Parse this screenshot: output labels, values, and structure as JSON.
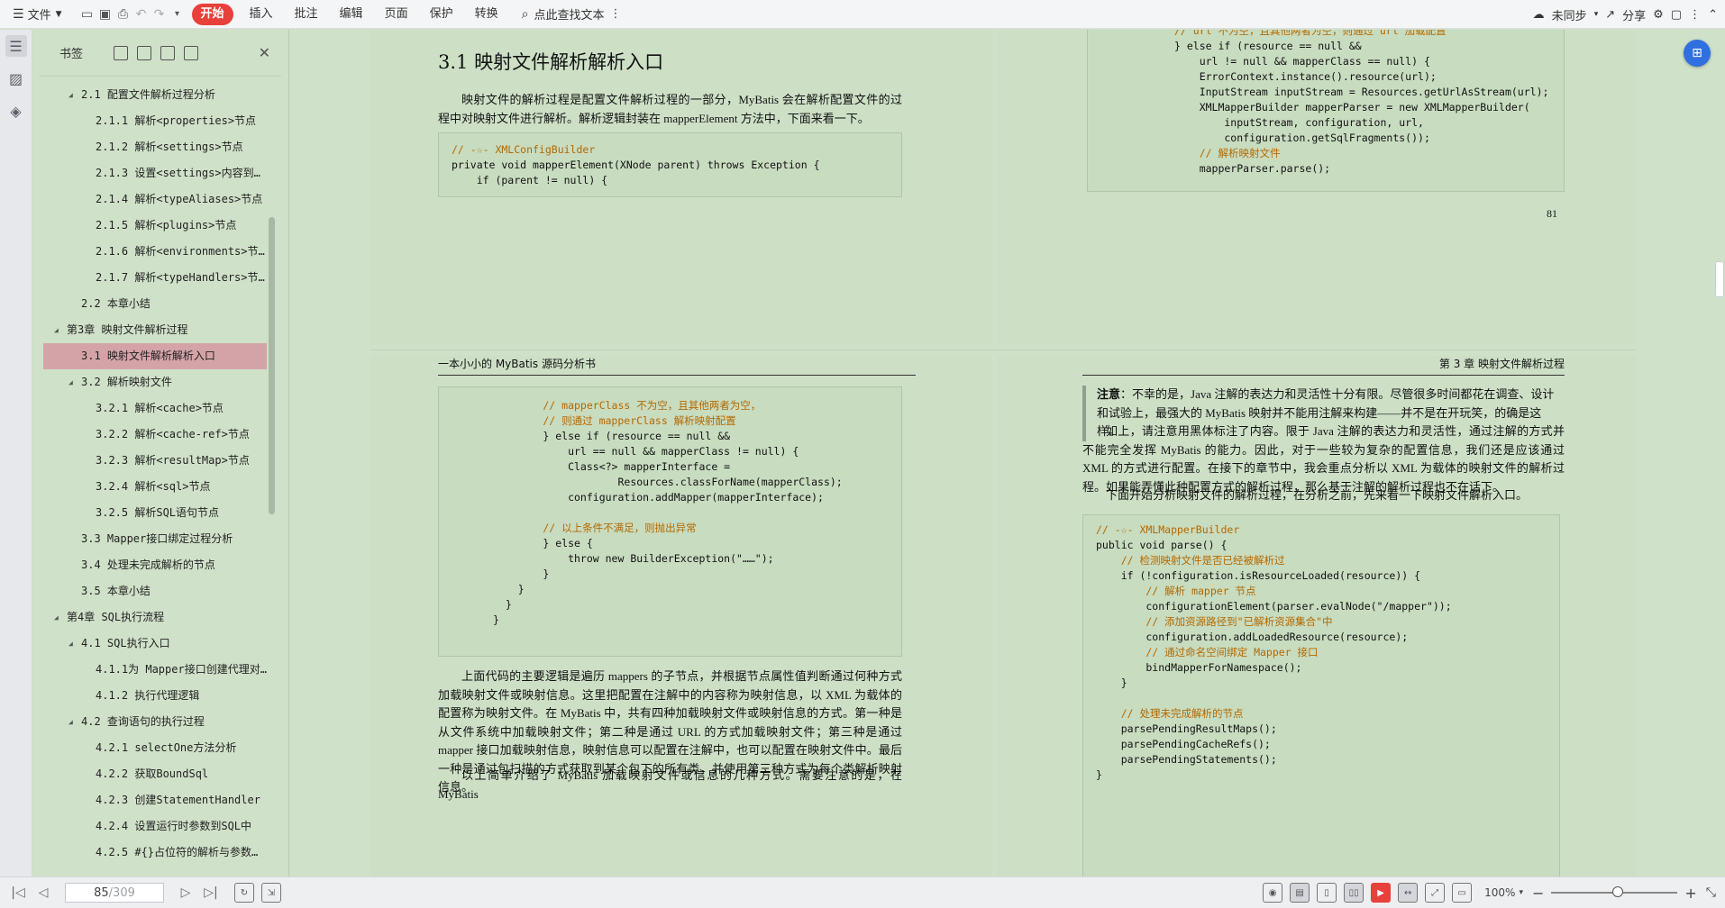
{
  "toolbar": {
    "file_label": "文件",
    "menu": [
      "开始",
      "插入",
      "批注",
      "编辑",
      "页面",
      "保护",
      "转换"
    ],
    "search_placeholder": "点此查找文本",
    "sync_label": "未同步",
    "share_label": "分享"
  },
  "bookmarks": {
    "title": "书签",
    "items": [
      {
        "level": 1,
        "expanded": true,
        "label": "2.1 配置文件解析过程分析"
      },
      {
        "level": 3,
        "label": "2.1.1 解析<properties>节点"
      },
      {
        "level": 3,
        "label": "2.1.2 解析<settings>节点"
      },
      {
        "level": 3,
        "label": "2.1.3 设置<settings>内容到Co…"
      },
      {
        "level": 3,
        "label": "2.1.4 解析<typeAliases>节点"
      },
      {
        "level": 3,
        "label": "2.1.5 解析<plugins>节点"
      },
      {
        "level": 3,
        "label": "2.1.6 解析<environments>节点"
      },
      {
        "level": 3,
        "label": "2.1.7 解析<typeHandlers>节点"
      },
      {
        "level": 2,
        "label": "2.2 本章小结"
      },
      {
        "level": 0,
        "expanded": true,
        "label": "第3章 映射文件解析过程"
      },
      {
        "level": 2,
        "selected": true,
        "label": "3.1 映射文件解析解析入口"
      },
      {
        "level": 1,
        "expanded": true,
        "label": "3.2 解析映射文件"
      },
      {
        "level": 3,
        "label": "3.2.1 解析<cache>节点"
      },
      {
        "level": 3,
        "label": "3.2.2 解析<cache-ref>节点"
      },
      {
        "level": 3,
        "label": "3.2.3 解析<resultMap>节点"
      },
      {
        "level": 3,
        "label": "3.2.4 解析<sql>节点"
      },
      {
        "level": 3,
        "label": "3.2.5 解析SQL语句节点"
      },
      {
        "level": 2,
        "label": "3.3 Mapper接口绑定过程分析"
      },
      {
        "level": 2,
        "label": "3.4 处理未完成解析的节点"
      },
      {
        "level": 2,
        "label": "3.5 本章小结"
      },
      {
        "level": 0,
        "expanded": true,
        "label": "第4章 SQL执行流程"
      },
      {
        "level": 1,
        "expanded": true,
        "label": "4.1 SQL执行入口"
      },
      {
        "level": 3,
        "label": "4.1.1为 Mapper接口创建代理对象"
      },
      {
        "level": 3,
        "label": "4.1.2 执行代理逻辑"
      },
      {
        "level": 1,
        "expanded": true,
        "label": "4.2 查询语句的执行过程"
      },
      {
        "level": 3,
        "label": "4.2.1 selectOne方法分析"
      },
      {
        "level": 3,
        "label": "4.2.2 获取BoundSql"
      },
      {
        "level": 3,
        "label": "4.2.3 创建StatementHandler"
      },
      {
        "level": 3,
        "label": "4.2.4 设置运行时参数到SQL中"
      },
      {
        "level": 3,
        "label": "4.2.5 #{}占位符的解析与参数…"
      }
    ]
  },
  "doc": {
    "section_title": "3.1 映射文件解析解析入口",
    "intro_para": "映射文件的解析过程是配置文件解析过程的一部分，MyBatis 会在解析配置文件的过程中对映射文件进行解析。解析逻辑封装在 mapperElement 方法中，下面来看一下。",
    "code1": [
      "// -☆- XMLConfigBuilder",
      "private void mapperElement(XNode parent) throws Exception {",
      "    if (parent != null) {"
    ],
    "code_topright": [
      "// url 不为空，且其他两者为空，则通过 url 加载配置",
      "} else if (resource == null &&",
      "    url != null && mapperClass == null) {",
      "    ErrorContext.instance().resource(url);",
      "    InputStream inputStream = Resources.getUrlAsStream(url);",
      "    XMLMapperBuilder mapperParser = new XMLMapperBuilder(",
      "        inputStream, configuration, url,",
      "        configuration.getSqlFragments());",
      "    // 解析映射文件",
      "    mapperParser.parse();"
    ],
    "page_number": "81",
    "left_header": "一本小小的 MyBatis 源码分析书",
    "right_header": "第 3 章  映射文件解析过程",
    "code2": [
      "        // mapperClass 不为空，且其他两者为空，",
      "        // 则通过 mapperClass 解析映射配置",
      "        } else if (resource == null &&",
      "            url == null && mapperClass != null) {",
      "            Class<?> mapperInterface =",
      "                    Resources.classForName(mapperClass);",
      "            configuration.addMapper(mapperInterface);",
      "",
      "        // 以上条件不满足，则抛出异常",
      "        } else {",
      "            throw new BuilderException(\"……\");",
      "        }",
      "    }",
      "  }",
      "}"
    ],
    "para2": "上面代码的主要逻辑是遍历 mappers 的子节点，并根据节点属性值判断通过何种方式加载映射文件或映射信息。这里把配置在注解中的内容称为映射信息，以 XML 为载体的配置称为映射文件。在 MyBatis 中，共有四种加载映射文件或映射信息的方式。第一种是从文件系统中加载映射文件；第二种是通过 URL 的方式加载映射文件；第三种是通过 mapper 接口加载映射信息，映射信息可以配置在注解中，也可以配置在映射文件中。最后一种是通过包扫描的方式获取到某个包下的所有类，并使用第三种方式为每个类解析映射信息。",
    "para3": "以上简单介绍了 MyBatis 加载映射文件或信息的几种方式。需要注意的是，在 MyBatis",
    "note_label": "注意",
    "note_text": "：不幸的是，Java 注解的表达力和灵活性十分有限。尽管很多时间都花在调查、设计和试验上，最强大的 MyBatis 映射并不能用注解来构建——并不是在开玩笑，的确是这样。",
    "para4": "如上，请注意用黑体标注了内容。限于 Java 注解的表达力和灵活性，通过注解的方式并不能完全发挥 MyBatis 的能力。因此，对于一些较为复杂的配置信息，我们还是应该通过 XML 的方式进行配置。在接下的章节中，我会重点分析以 XML 为载体的映射文件的解析过程。如果能弄懂此种配置方式的解析过程，那么基于注解的解析过程也不在话下。",
    "para5": "下面开始分析映射文件的解析过程，在分析之前，先来看一下映射文件解析入口。",
    "code3": [
      "// -☆- XMLMapperBuilder",
      "public void parse() {",
      "    // 检测映射文件是否已经被解析过",
      "    if (!configuration.isResourceLoaded(resource)) {",
      "        // 解析 mapper 节点",
      "        configurationElement(parser.evalNode(\"/mapper\"));",
      "        // 添加资源路径到\"已解析资源集合\"中",
      "        configuration.addLoadedResource(resource);",
      "        // 通过命名空间绑定 Mapper 接口",
      "        bindMapperForNamespace();",
      "    }",
      "",
      "    // 处理未完成解析的节点",
      "    parsePendingResultMaps();",
      "    parsePendingCacheRefs();",
      "    parsePendingStatements();",
      "}"
    ]
  },
  "status": {
    "current_page": "85",
    "total_pages": "/309",
    "zoom": "100%",
    "zoom_level": 0.5
  }
}
